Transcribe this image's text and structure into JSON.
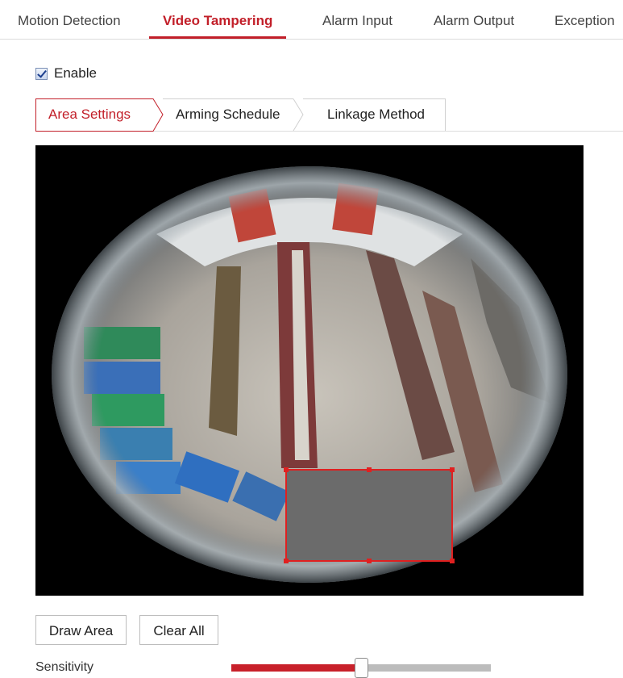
{
  "tabs": [
    {
      "label": "Motion Detection",
      "active": false
    },
    {
      "label": "Video Tampering",
      "active": true
    },
    {
      "label": "Alarm Input",
      "active": false
    },
    {
      "label": "Alarm Output",
      "active": false
    },
    {
      "label": "Exception",
      "active": false
    }
  ],
  "enable": {
    "label": "Enable",
    "checked": true
  },
  "subtabs": [
    {
      "label": "Area Settings",
      "active": true
    },
    {
      "label": "Arming Schedule",
      "active": false
    },
    {
      "label": "Linkage Method",
      "active": false
    }
  ],
  "buttons": {
    "draw_area": "Draw Area",
    "clear_all": "Clear All"
  },
  "sensitivity": {
    "label": "Sensitivity",
    "value_fraction": 0.5
  },
  "colors": {
    "accent": "#c21f29",
    "tamper_area": "#6b6b6b",
    "slider_track": "#bcbcbc"
  }
}
